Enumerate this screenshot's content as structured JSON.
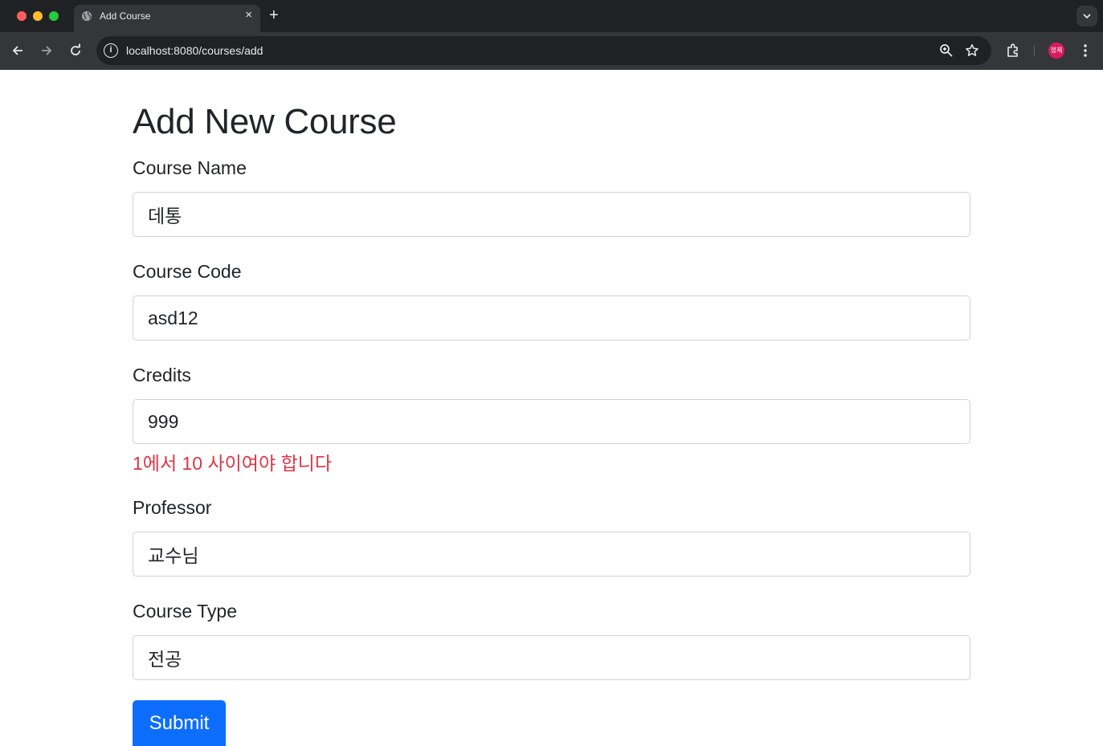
{
  "browser": {
    "tab_title": "Add Course",
    "tab_close": "×",
    "new_tab": "+",
    "url": "localhost:8080/courses/add",
    "avatar_text": "정제"
  },
  "form": {
    "title": "Add New Course",
    "fields": [
      {
        "label": "Course Name",
        "value": "데통"
      },
      {
        "label": "Course Code",
        "value": "asd12"
      },
      {
        "label": "Credits",
        "value": "999",
        "error": "1에서 10 사이여야 합니다"
      },
      {
        "label": "Professor",
        "value": "교수님"
      },
      {
        "label": "Course Type",
        "value": "전공"
      }
    ],
    "submit_label": "Submit"
  },
  "colors": {
    "primary": "#0d6efd",
    "error": "#dc3545",
    "text": "#212529"
  }
}
